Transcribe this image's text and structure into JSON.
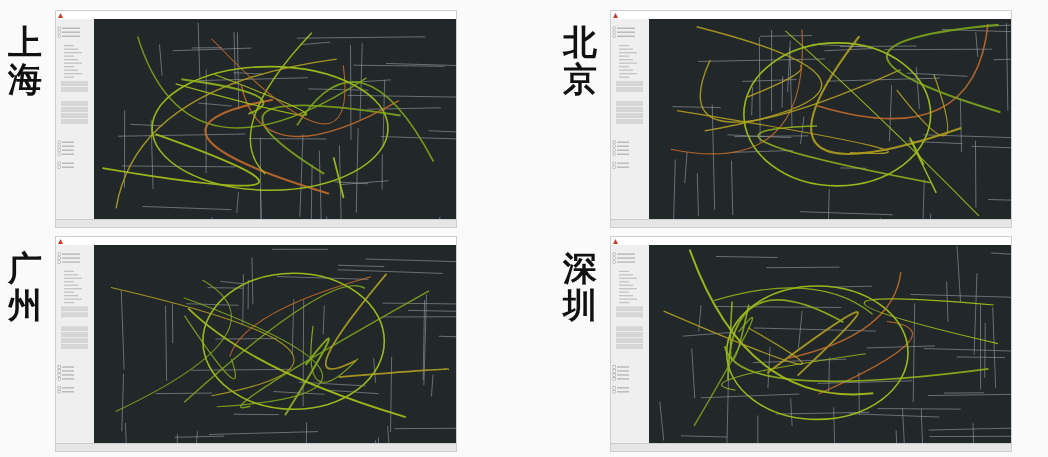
{
  "panels": [
    {
      "city": "上海"
    },
    {
      "city": "北京"
    },
    {
      "city": "广州"
    },
    {
      "city": "深圳"
    }
  ]
}
